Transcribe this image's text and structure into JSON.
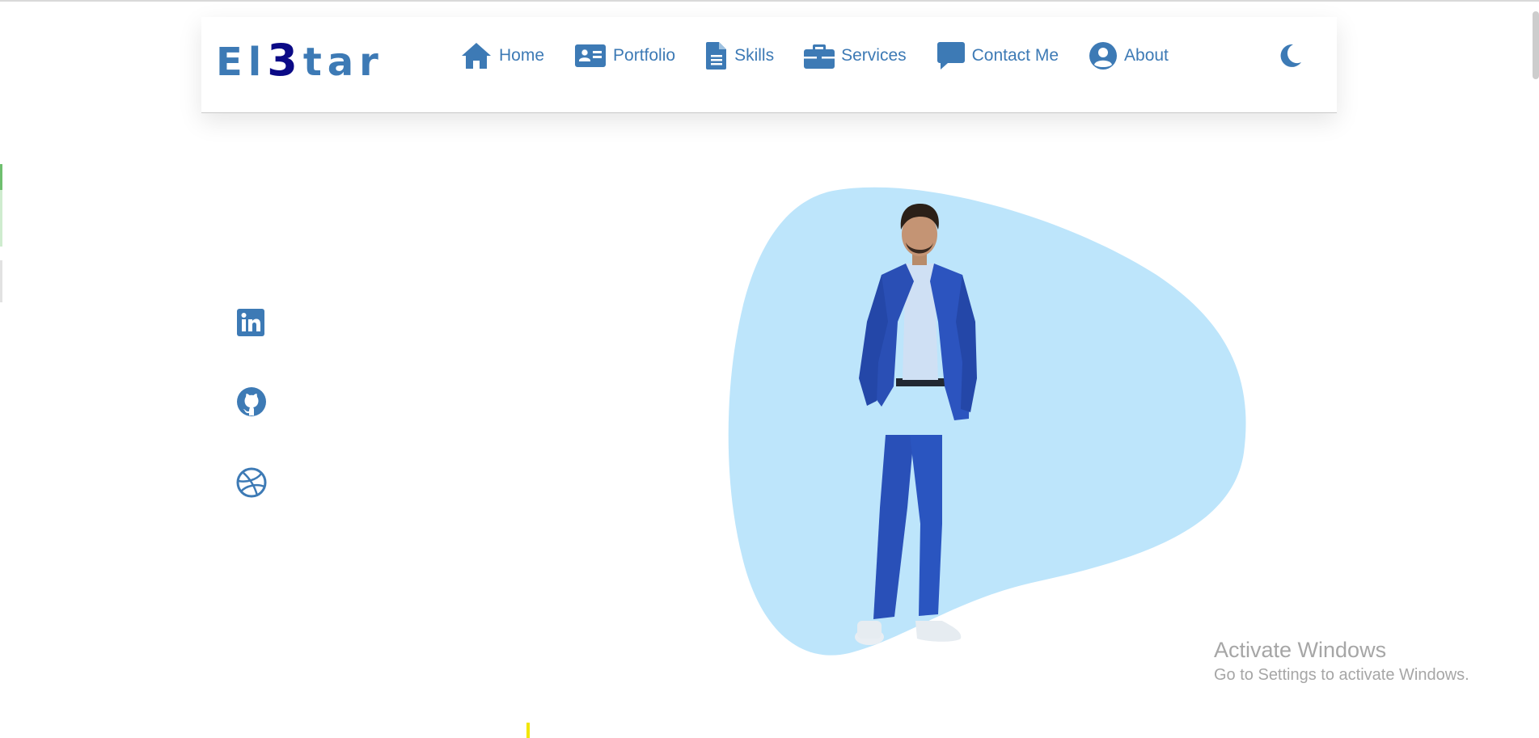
{
  "logo": {
    "prefix": "El",
    "highlight": "3",
    "suffix": "tar"
  },
  "nav": [
    {
      "label": "Home",
      "icon": "home-icon"
    },
    {
      "label": "Portfolio",
      "icon": "id-card-icon"
    },
    {
      "label": "Skills",
      "icon": "document-icon"
    },
    {
      "label": "Services",
      "icon": "briefcase-icon"
    },
    {
      "label": "Contact Me",
      "icon": "chat-icon"
    },
    {
      "label": "About",
      "icon": "user-circle-icon"
    }
  ],
  "theme_toggle": {
    "icon": "moon-icon"
  },
  "social": [
    {
      "icon": "linkedin-icon"
    },
    {
      "icon": "github-icon"
    },
    {
      "icon": "dribbble-icon"
    }
  ],
  "watermark": {
    "title": "Activate Windows",
    "subtitle": "Go to Settings to activate Windows."
  },
  "colors": {
    "accent": "#3d7ab5",
    "logo_highlight": "#0b0a86",
    "blob": "#bde5fb"
  }
}
